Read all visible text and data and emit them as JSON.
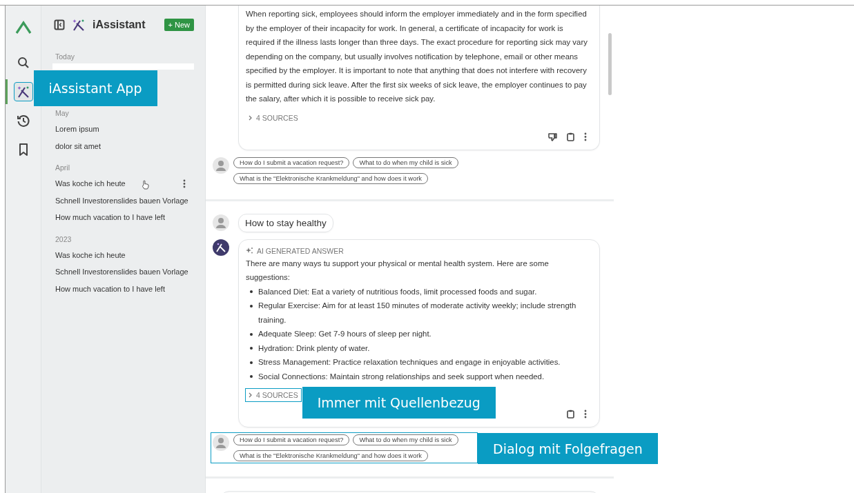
{
  "rail": {
    "items": [
      {
        "kind": "search",
        "selected": false
      },
      {
        "kind": "assistant",
        "selected": true
      },
      {
        "kind": "history",
        "selected": false
      },
      {
        "kind": "bookmark",
        "selected": false
      }
    ]
  },
  "sidebar": {
    "title": "iAssistant",
    "new_button": "+ New",
    "groups": [
      {
        "label": "Today"
      },
      {
        "label": "May",
        "items": [
          {
            "label": "Lorem ipsum",
            "hovered": false
          },
          {
            "label": "dolor sit amet",
            "hovered": false
          }
        ]
      },
      {
        "label": "April",
        "items": [
          {
            "label": "Was koche ich heute",
            "hovered": true
          },
          {
            "label": "Schnell Investorenslides bauen Vorlage",
            "hovered": false
          },
          {
            "label": "How much vacation to I have left",
            "hovered": false
          }
        ]
      },
      {
        "label": "2023",
        "items": [
          {
            "label": "Was koche ich heute",
            "hovered": false
          },
          {
            "label": "Schnell Investorenslides bauen Vorlage",
            "hovered": false
          },
          {
            "label": "How much vacation to I have left",
            "hovered": false
          }
        ]
      }
    ]
  },
  "chat": {
    "sections": [
      {
        "blocks": [
          {
            "kind": "answer",
            "text": "When reporting sick, employees should inform the employer immediately and in the form specified by the employer of their incapacity for work. In general, a certificate of incapacity for work is required if the illness lasts longer than three days. The exact procedure for reporting sick may vary depending on the company, but usually involves notification by telephone, email or other means specified by the employer. It is important to note that anything that does not interfere with recovery is permitted during sick leave. After the first six weeks of sick leave, the employer continues to pay the salary, after which it is possible to receive sick pay.",
            "sources": "4 SOURCES",
            "actions": [
              {
                "kind": "dislike"
              },
              {
                "kind": "copy"
              },
              {
                "kind": "more"
              }
            ]
          },
          {
            "kind": "suggestions",
            "items": [
              "How do I submit a vacation request?",
              "What to do when my child is sick",
              "What is the \"Elektronische Krankmeldung\" and how does it work"
            ]
          }
        ]
      },
      {
        "blocks": [
          {
            "kind": "question",
            "text": "How to stay healthy"
          },
          {
            "kind": "answer",
            "bot_avatar": true,
            "header": "AI GENERATED ANSWER",
            "text": "There are many ways tu support your physical or mental health system.  Here are some suggestions:",
            "bullets": [
              "Balanced Diet: Eat a variety of nutritious foods, limit processed foods and sugar.",
              "Regular Exercise: Aim for at least 150 minutes of moderate activity weekly; include strength training.",
              "Adequate Sleep: Get 7-9 hours of sleep per night.",
              "Hydration: Drink plenty of water.",
              "Stress Management: Practice relaxation techniques and engage in enjoyable activities.",
              "Social Connections: Maintain strong relationships and seek support when needed."
            ],
            "sources": "4 SOURCES",
            "actions": [
              {
                "kind": "copy"
              },
              {
                "kind": "more"
              }
            ]
          },
          {
            "kind": "suggestions",
            "items": [
              "How do I submit a vacation request?",
              "What to do when my child is sick",
              "What is the \"Elektronische Krankmeldung\" and how does it work"
            ]
          }
        ]
      },
      {
        "blocks": [
          {
            "kind": "composer"
          }
        ]
      }
    ]
  },
  "callouts": [
    {
      "text": "iAssistant App"
    },
    {
      "text": "Immer mit Quellenbezug"
    },
    {
      "text": "Dialog mit Folgefragen"
    }
  ]
}
